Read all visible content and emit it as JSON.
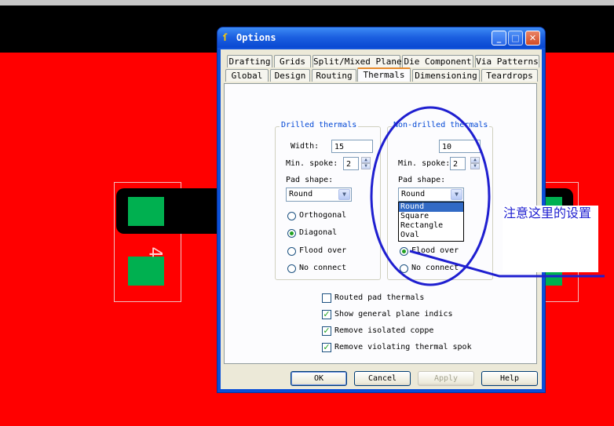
{
  "window": {
    "title": "Options",
    "minimize_glyph": "_",
    "maximize_glyph": "□",
    "close_glyph": "✕"
  },
  "tabs_row1": [
    "Drafting",
    "Grids",
    "Split/Mixed Plane",
    "Die Component",
    "Via Patterns"
  ],
  "tabs_row2": [
    "Global",
    "Design",
    "Routing",
    "Thermals",
    "Dimensioning",
    "Teardrops"
  ],
  "active_tab": "Thermals",
  "drilled": {
    "legend": "Drilled thermals",
    "width_label": "Width:",
    "width_value": "15",
    "min_spoke_label": "Min. spoke:",
    "min_spoke_value": "2",
    "pad_shape_label": "Pad shape:",
    "pad_shape_value": "Round",
    "radio_orthogonal": "Orthogonal",
    "radio_diagonal": "Diagonal",
    "radio_flood": "Flood over",
    "radio_noconnect": "No connect"
  },
  "nondrilled": {
    "legend": "Non-drilled thermals",
    "width_value": "10",
    "min_spoke_label": "Min. spoke:",
    "min_spoke_value": "2",
    "pad_shape_label": "Pad shape:",
    "pad_shape_value": "Round",
    "options": [
      "Round",
      "Square",
      "Rectangle",
      "Oval"
    ],
    "radio_flood": "Flood over",
    "radio_noconnect": "No connect"
  },
  "checkboxes": [
    {
      "label": "Routed pad thermals",
      "checked": false
    },
    {
      "label": "Show general plane indics",
      "checked": true
    },
    {
      "label": "Remove isolated coppe",
      "checked": true
    },
    {
      "label": "Remove violating thermal spok",
      "checked": true
    }
  ],
  "buttons": {
    "ok": "OK",
    "cancel": "Cancel",
    "apply": "Apply",
    "help": "Help"
  },
  "annotation": "注意这里的设置",
  "pcb_label": "4",
  "colors": {
    "background": "#ff0000",
    "pad": "#00b050",
    "annotation": "#1f1fd0",
    "titlebar": "#0a49d2"
  }
}
